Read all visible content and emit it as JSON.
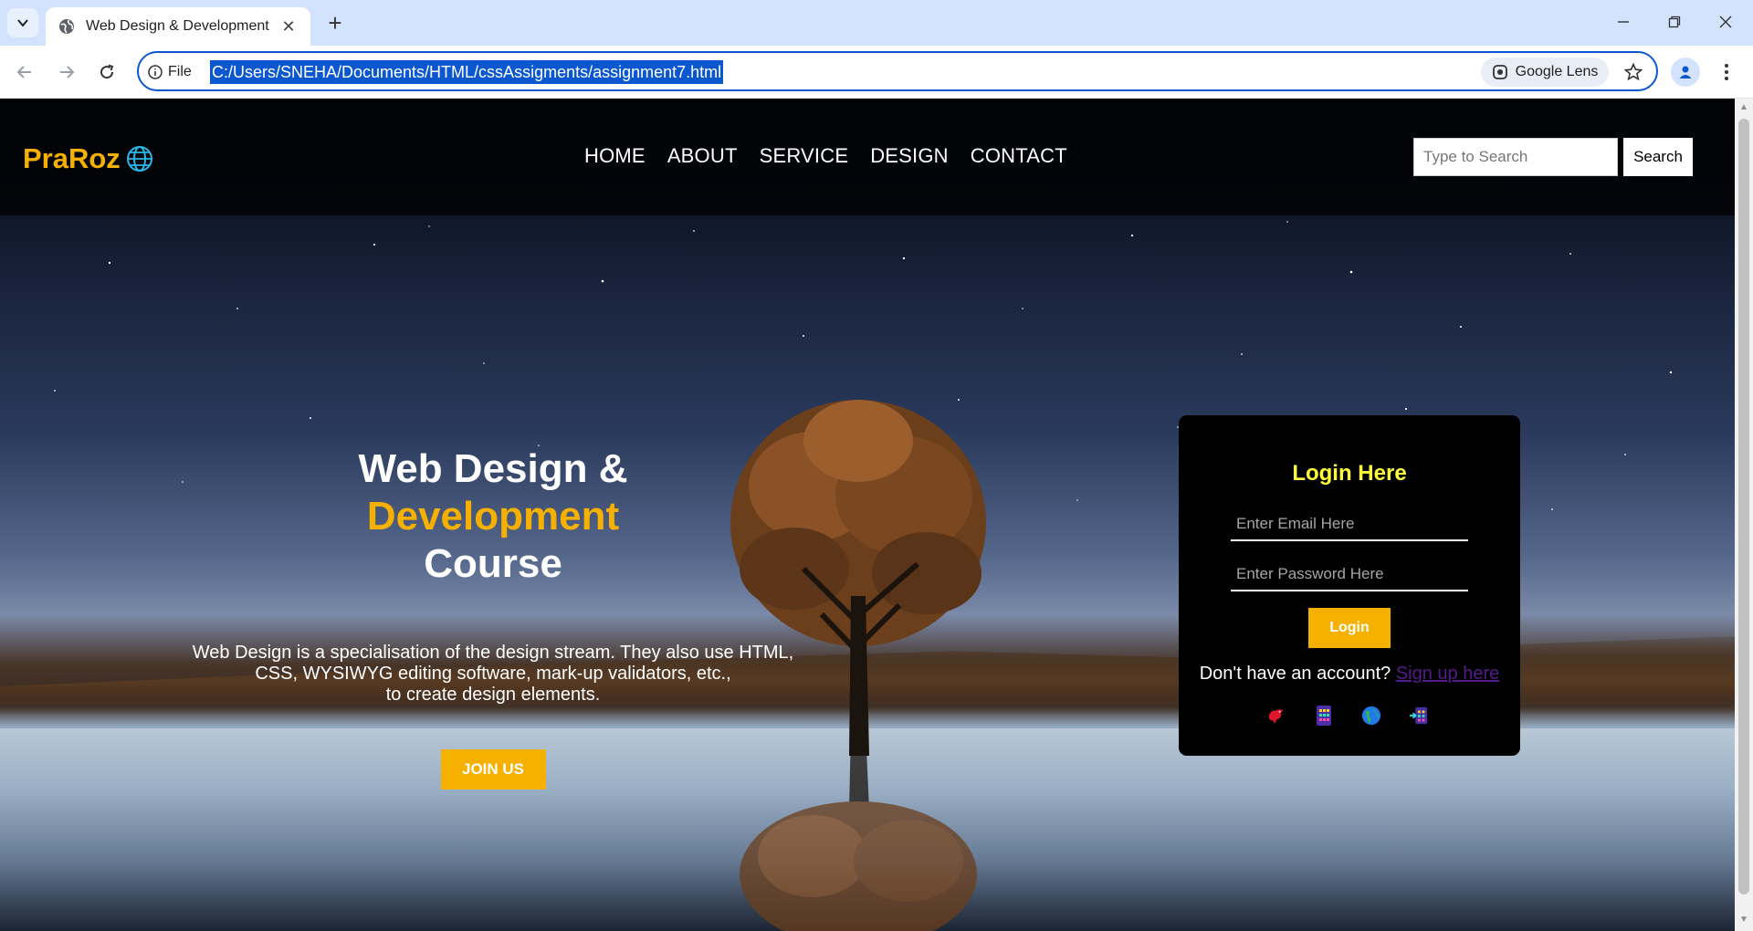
{
  "browser": {
    "tab_title": "Web Design & Development",
    "site_info_label": "File",
    "url": "C:/Users/SNEHA/Documents/HTML/cssAssigments/assignment7.html",
    "lens_label": "Google Lens"
  },
  "site": {
    "logo_text": "PraRoz",
    "nav": [
      "HOME",
      "ABOUT",
      "SERVICE",
      "DESIGN",
      "CONTACT"
    ],
    "search_placeholder": "Type to Search",
    "search_button": "Search"
  },
  "hero": {
    "title_line1": "Web Design &",
    "title_accent": "Development",
    "title_line3": "Course",
    "desc_line1": "Web Design is a specialisation of the design stream. They also use HTML,",
    "desc_line2": "CSS, WYSIWYG editing software, mark-up validators, etc.,",
    "desc_line3": "to create design elements.",
    "cta": "JOIN US"
  },
  "login": {
    "title": "Login Here",
    "email_placeholder": "Enter Email Here",
    "password_placeholder": "Enter Password Here",
    "button": "Login",
    "signup_prompt": "Don't have an account?",
    "signup_link": "Sign up here",
    "social_icons": [
      "bird-icon",
      "grid-app-icon",
      "globe-icon",
      "arrow-grid-icon"
    ]
  },
  "colors": {
    "accent": "#f6b100",
    "login_title": "#ffff3a",
    "link": "#551a8b",
    "chrome_tabbar": "#d3e3fd",
    "omnibox_border": "#0b57d0"
  }
}
